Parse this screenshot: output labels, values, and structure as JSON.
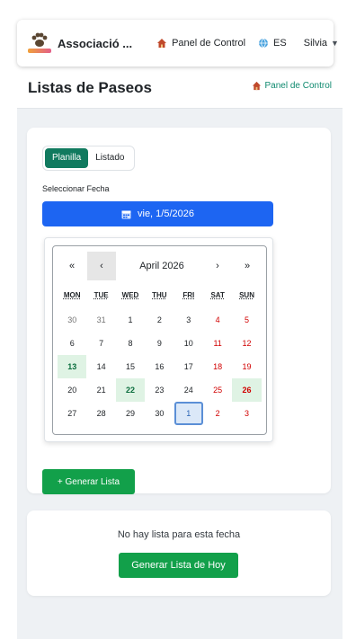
{
  "nav": {
    "brand_name": "Associació ...",
    "panel_label": "Panel de Control",
    "lang_label": "ES",
    "user_label": "Silvia"
  },
  "header": {
    "title": "Listas de Paseos",
    "panel_link": "Panel de Control"
  },
  "tabs": [
    {
      "label": "Planilla",
      "active": true
    },
    {
      "label": "Listado",
      "active": false
    }
  ],
  "date_picker": {
    "label": "Seleccionar Fecha",
    "value": "vie, 1/5/2026"
  },
  "calendar": {
    "month_label": "April 2026",
    "prev_year": "«",
    "prev_month": "‹",
    "next_month": "›",
    "next_year": "»",
    "weekdays": [
      "MON",
      "TUE",
      "WED",
      "THU",
      "FRI",
      "SAT",
      "SUN"
    ],
    "weeks": [
      [
        "30",
        "31",
        "1",
        "2",
        "3",
        "4",
        "5"
      ],
      [
        "6",
        "7",
        "8",
        "9",
        "10",
        "11",
        "12"
      ],
      [
        "13",
        "14",
        "15",
        "16",
        "17",
        "18",
        "19"
      ],
      [
        "20",
        "21",
        "22",
        "23",
        "24",
        "25",
        "26"
      ],
      [
        "27",
        "28",
        "29",
        "30",
        "1",
        "2",
        "3"
      ]
    ]
  },
  "actions": {
    "generate_label": "+ Generar Lista"
  },
  "empty_state": {
    "message": "No hay lista para esta fecha",
    "button_label": "Generar Lista de Hoy"
  },
  "colors": {
    "primary_green": "#117a5f",
    "button_green": "#12a04a",
    "date_blue": "#1d65f2",
    "weekend_red": "#d10000"
  }
}
